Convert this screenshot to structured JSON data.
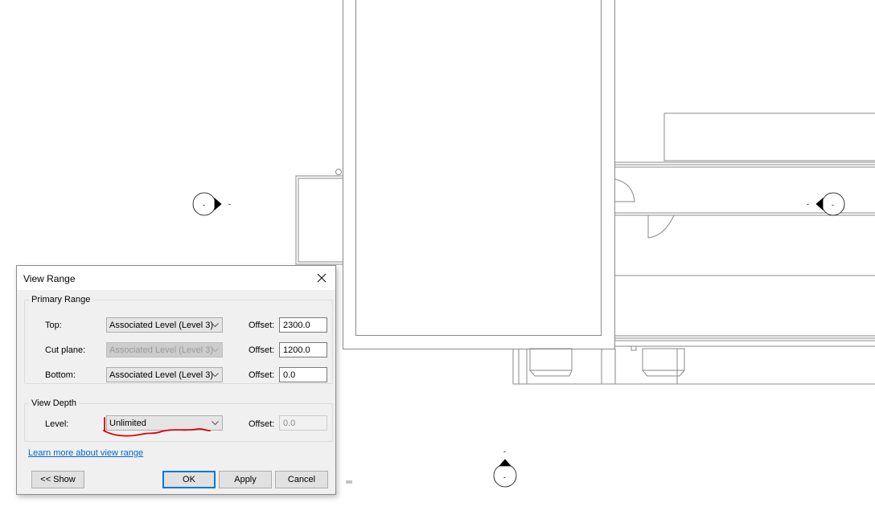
{
  "dialog": {
    "title": "View Range",
    "primary_range": {
      "label": "Primary Range",
      "rows": [
        {
          "label": "Top:",
          "level": "Associated Level (Level 3)",
          "offset_label": "Offset:",
          "offset": "2300.0",
          "enabled": true
        },
        {
          "label": "Cut plane:",
          "level": "Associated Level (Level 3)",
          "offset_label": "Offset:",
          "offset": "1200.0",
          "enabled": false
        },
        {
          "label": "Bottom:",
          "level": "Associated Level (Level 3)",
          "offset_label": "Offset:",
          "offset": "0.0",
          "enabled": true
        }
      ]
    },
    "view_depth": {
      "label": "View Depth",
      "row": {
        "label": "Level:",
        "level": "Unlimited",
        "offset_label": "Offset:",
        "offset": "0.0",
        "enabled": false
      }
    },
    "help_link": "Learn more about view range",
    "buttons": {
      "show": "<< Show",
      "ok": "OK",
      "apply": "Apply",
      "cancel": "Cancel"
    }
  },
  "colors": {
    "drawing_line": "#8a8a8a",
    "annotation": "#e0000b",
    "link": "#0066cc",
    "default_button_border": "#0078d7"
  }
}
